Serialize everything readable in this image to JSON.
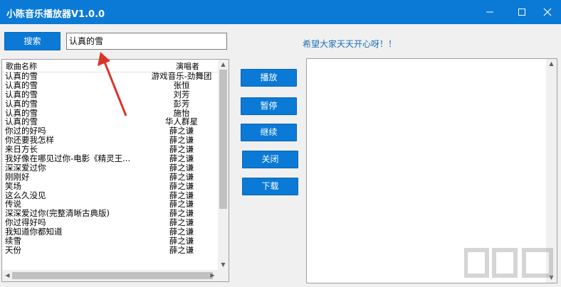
{
  "window": {
    "title": "小陈音乐播放器V1.0.0",
    "minimize_icon": "minimize-icon",
    "maximize_icon": "maximize-icon",
    "close_icon": "close-icon"
  },
  "search": {
    "button_label": "搜索",
    "value": "认真的雪"
  },
  "greeting": "希望大家天天开心呀！！",
  "list": {
    "columns": [
      "歌曲名称",
      "演唱者"
    ],
    "rows": [
      {
        "name": "认真的雪",
        "artist": "游戏音乐-劲舞团"
      },
      {
        "name": "认真的雪",
        "artist": "张恒"
      },
      {
        "name": "认真的雪",
        "artist": "刘芳"
      },
      {
        "name": "认真的雪",
        "artist": "彭芳"
      },
      {
        "name": "认真的雪",
        "artist": "施怡"
      },
      {
        "name": "认真的雪",
        "artist": "华人群星"
      },
      {
        "name": "你过的好吗",
        "artist": "薛之谦"
      },
      {
        "name": "你还要我怎样",
        "artist": "薛之谦"
      },
      {
        "name": "来日方长",
        "artist": "薛之谦"
      },
      {
        "name": "我好像在哪见过你-电影《精灵王...",
        "artist": "薛之谦"
      },
      {
        "name": "深深爱过你",
        "artist": "薛之谦"
      },
      {
        "name": "刚刚好",
        "artist": "薛之谦"
      },
      {
        "name": "笑场",
        "artist": "薛之谦"
      },
      {
        "name": "这么久没见",
        "artist": "薛之谦"
      },
      {
        "name": "传说",
        "artist": "薛之谦"
      },
      {
        "name": "深深爱过你(完整清晰古典版)",
        "artist": "薛之谦"
      },
      {
        "name": "你过得好吗",
        "artist": "薛之谦"
      },
      {
        "name": "我知道你都知道",
        "artist": "薛之谦"
      },
      {
        "name": "续雪",
        "artist": "薛之谦"
      },
      {
        "name": "天份",
        "artist": "薛之谦"
      }
    ]
  },
  "buttons": {
    "play": "播放",
    "pause": "暂停",
    "resume": "继续",
    "close": "关闭",
    "download": "下载"
  },
  "colors": {
    "accent": "#0b7ad6",
    "greeting": "#1a6fb5",
    "annotation_arrow": "#d9342b"
  }
}
